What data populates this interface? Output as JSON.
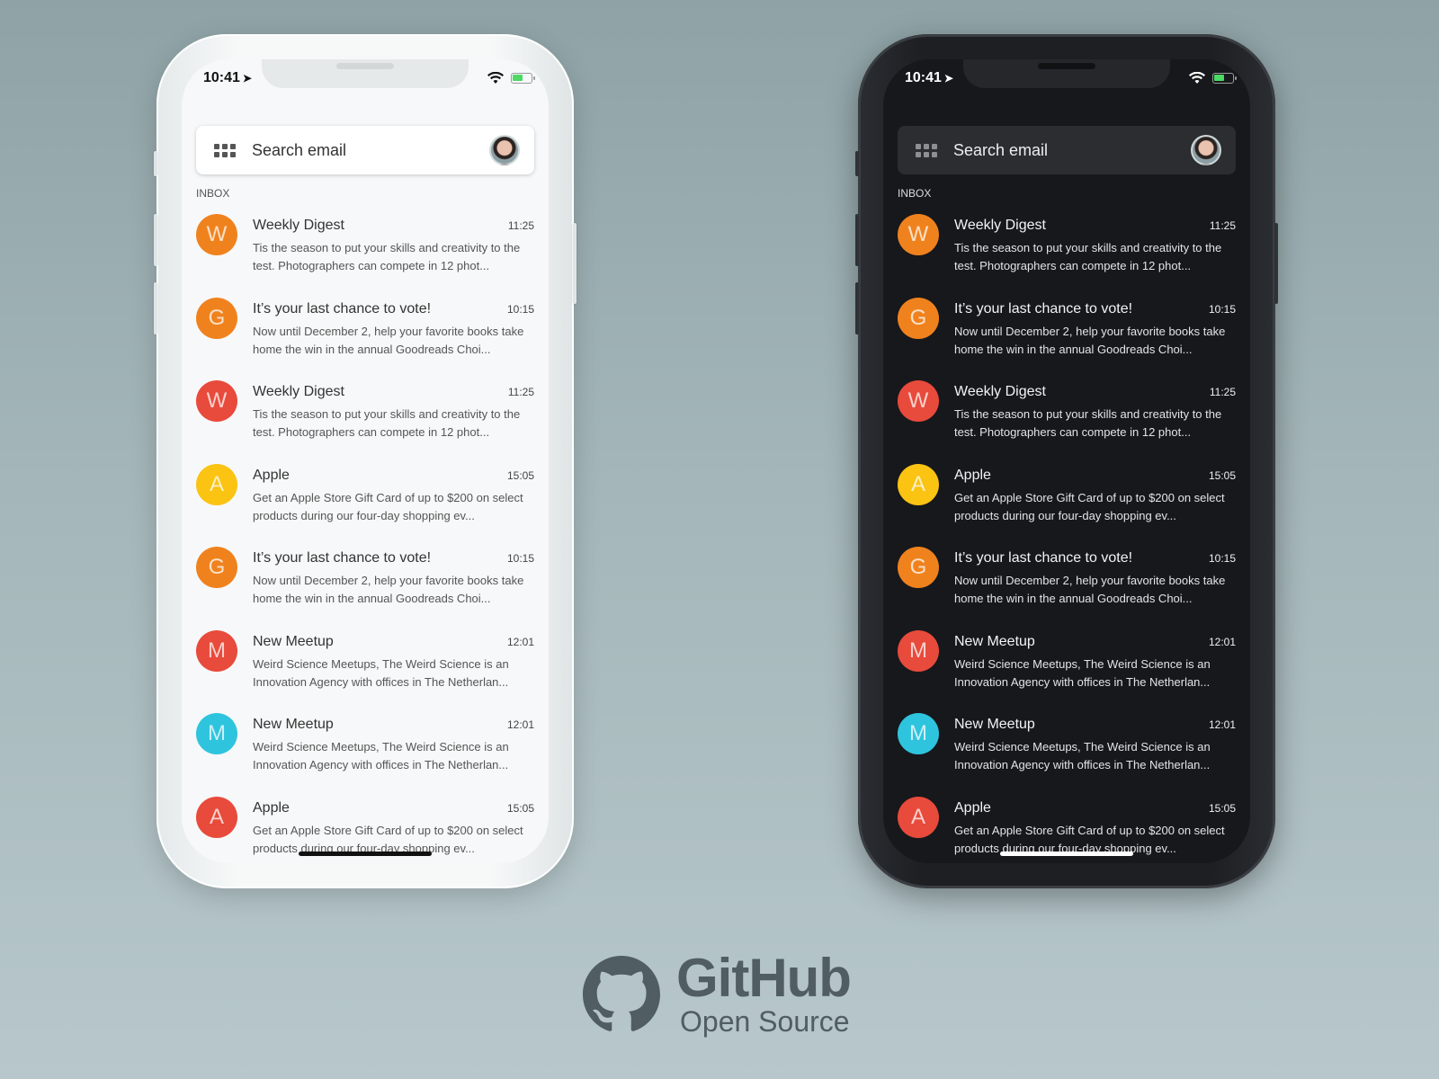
{
  "status_bar": {
    "time": "10:41",
    "location_icon": "location-arrow-icon",
    "wifi_icon": "wifi-icon",
    "battery_icon": "battery-charging-icon"
  },
  "search": {
    "placeholder": "Search email",
    "menu_icon": "apps-grid-icon",
    "avatar": "user-avatar"
  },
  "section_label": "INBOX",
  "themes": [
    "light",
    "dark"
  ],
  "emails": [
    {
      "initial": "W",
      "color": "#f0821e",
      "sender": "Weekly Digest",
      "time": "11:25",
      "snippet": "Tis the season to put your skills and creativity to the test. Photographers can compete in 12 phot..."
    },
    {
      "initial": "G",
      "color": "#f0821e",
      "sender": "It’s your last chance to vote!",
      "time": "10:15",
      "snippet": "Now until December 2, help your favorite books take home the win in the annual Goodreads Choi..."
    },
    {
      "initial": "W",
      "color": "#e84a3b",
      "sender": "Weekly Digest",
      "time": "11:25",
      "snippet": "Tis the season to put your skills and creativity to the test. Photographers can compete in 12 phot..."
    },
    {
      "initial": "A",
      "color": "#fbc312",
      "sender": "Apple",
      "time": "15:05",
      "snippet": "Get an Apple Store Gift Card of up to $200 on select products during our four-day shopping ev..."
    },
    {
      "initial": "G",
      "color": "#f0821e",
      "sender": "It’s your last chance to vote!",
      "time": "10:15",
      "snippet": "Now until December 2, help your favorite books take home the win in the annual Goodreads Choi..."
    },
    {
      "initial": "M",
      "color": "#e84a3b",
      "sender": "New Meetup",
      "time": "12:01",
      "snippet": "Weird Science Meetups, The Weird Science is an Innovation Agency with offices in The Netherlan..."
    },
    {
      "initial": "M",
      "color": "#2ec4de",
      "sender": "New Meetup",
      "time": "12:01",
      "snippet": "Weird Science Meetups, The Weird Science is an Innovation Agency with offices in The Netherlan..."
    },
    {
      "initial": "A",
      "color": "#e84a3b",
      "sender": "Apple",
      "time": "15:05",
      "snippet": "Get an Apple Store Gift Card of up to $200 on select products during our four-day shopping ev..."
    }
  ],
  "branding": {
    "title": "GitHub",
    "subtitle": "Open Source"
  }
}
